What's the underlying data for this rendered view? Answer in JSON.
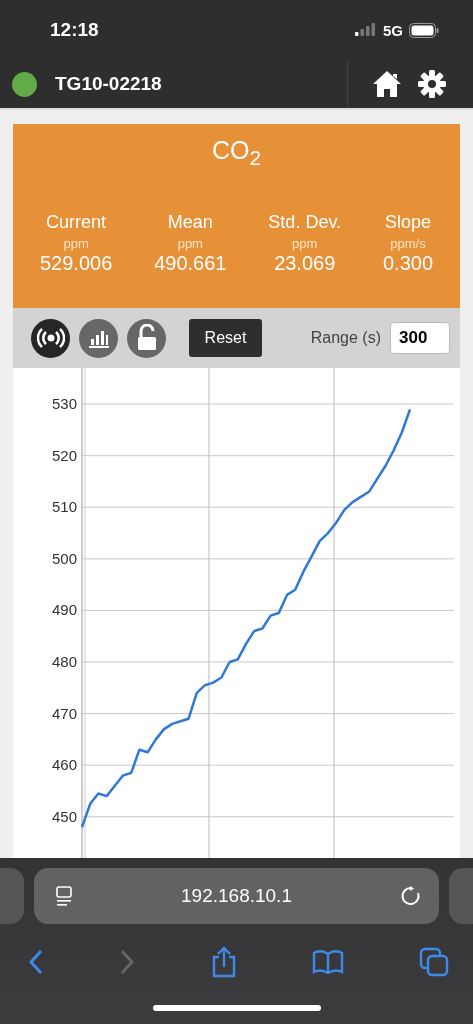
{
  "status_bar": {
    "time": "12:18",
    "network": "5G"
  },
  "header": {
    "device": "TG10-02218",
    "connected": true
  },
  "panel": {
    "title": "CO$_{2}$",
    "stats": [
      {
        "label": "Current",
        "unit": "ppm",
        "value": "529.006"
      },
      {
        "label": "Mean",
        "unit": "ppm",
        "value": "490.661"
      },
      {
        "label": "Std. Dev.",
        "unit": "ppm",
        "value": "23.069"
      },
      {
        "label": "Slope",
        "unit": "ppm/s",
        "value": "0.300"
      }
    ],
    "tools": [
      {
        "kind": "live",
        "selected": true
      },
      {
        "kind": "stats",
        "selected": false
      },
      {
        "kind": "lock",
        "selected": false
      }
    ],
    "reset": "Reset",
    "range_label": "Range (s)",
    "range_value": "300",
    "chart_data": {
      "type": "line",
      "grid": true,
      "ylim": [
        442,
        537
      ],
      "yticks": [
        450,
        460,
        470,
        480,
        490,
        500,
        510,
        520,
        530
      ],
      "categories": [
        null,
        null,
        null,
        null,
        null,
        null,
        null,
        null,
        null,
        null,
        null,
        null,
        null,
        null,
        null,
        null,
        null,
        null,
        null,
        null,
        null,
        null,
        null,
        null,
        null,
        null,
        null,
        null,
        null,
        null,
        null,
        null,
        null,
        null,
        null,
        null,
        null,
        null,
        null,
        null,
        null
      ],
      "series": [
        {
          "color": "#2f78d8",
          "values": [
            448,
            452.5,
            454.5,
            454,
            456,
            458,
            458.5,
            463,
            462.5,
            465,
            467,
            468,
            468.5,
            469,
            474,
            475.5,
            476,
            477,
            480,
            480.5,
            483.5,
            486,
            486.5,
            489,
            489.5,
            493,
            494,
            497.5,
            500.5,
            503.5,
            505,
            507,
            509.5,
            511,
            512,
            513,
            515.5,
            518,
            521,
            524.5,
            529
          ]
        }
      ]
    }
  },
  "browser": {
    "url": "192.168.10.1",
    "back_disabled": false,
    "forward_disabled": true
  }
}
